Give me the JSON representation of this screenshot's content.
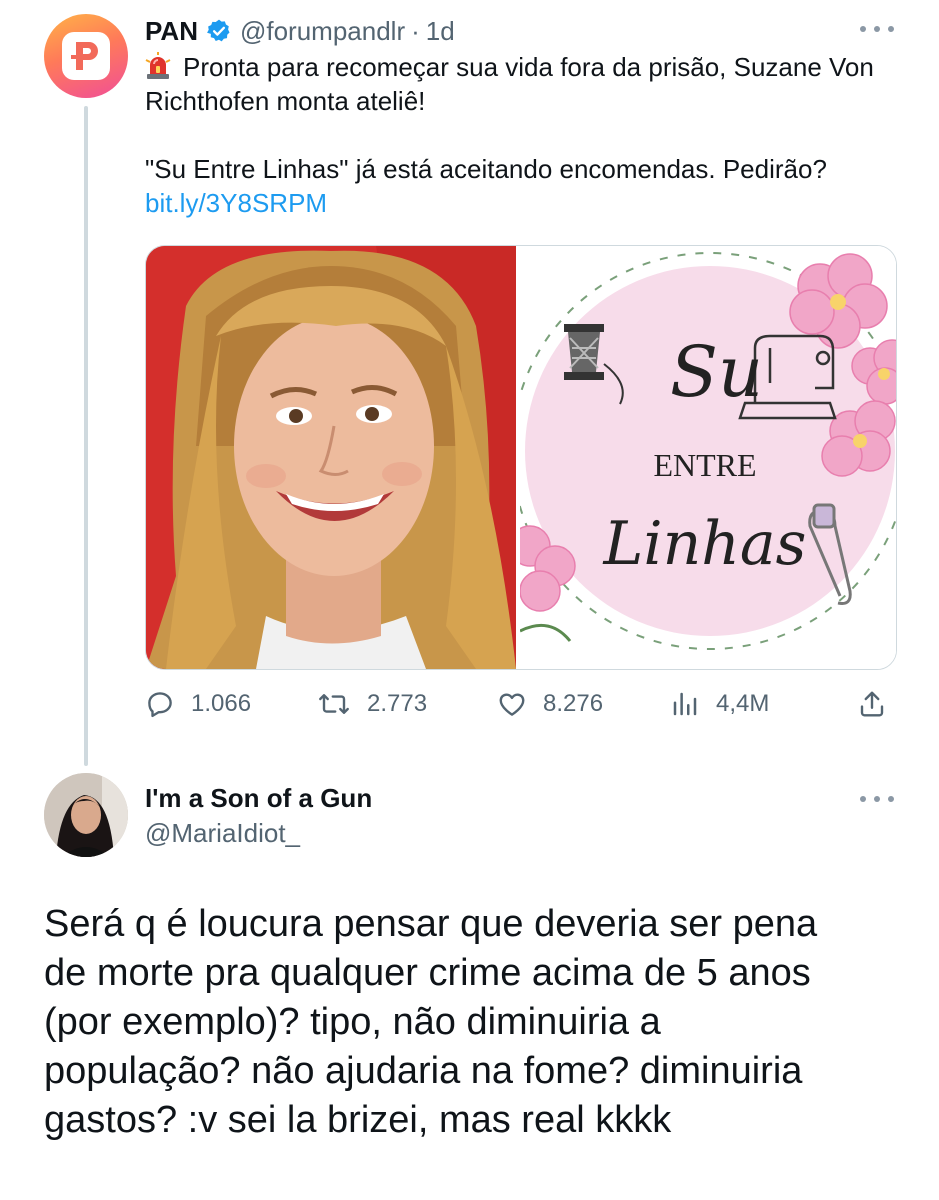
{
  "tweet": {
    "author_name": "PAN",
    "author_handle": "@forumpandlr",
    "separator": "·",
    "time": "1d",
    "text_line1": "Pronta para recomeçar sua vida fora da prisão, Suzane Von Richthofen monta ateliê!",
    "text_line2": "\"Su Entre Linhas\" já está aceitando encomendas. Pedirão?",
    "link": "bit.ly/3Y8SRPM",
    "media": {
      "logo_su": "Su",
      "logo_entre": "ENTRE",
      "logo_linhas": "Linhas"
    },
    "stats": {
      "replies": "1.066",
      "retweets": "2.773",
      "likes": "8.276",
      "views": "4,4M"
    },
    "icons": [
      "siren-icon",
      "verified-badge-icon",
      "more-icon",
      "reply-icon",
      "retweet-icon",
      "like-icon",
      "views-icon",
      "share-icon"
    ]
  },
  "reply": {
    "author_name": "I'm a Son of a Gun",
    "author_handle": "@MariaIdiot_",
    "lines": [
      "Será q é loucura pensar que deveria ser pena",
      "de morte pra qualquer crime acima de 5 anos",
      "(por exemplo)? tipo, não diminuiria a",
      "população? não ajudaria na fome? diminuiria",
      "gastos? :v sei la brizei, mas real kkkk"
    ]
  },
  "colors": {
    "text": "#0f1419",
    "muted": "#536471",
    "link": "#1d9bf0",
    "verified": "#1d9bf0",
    "thread_line": "#cfd9de",
    "photo_bg": "#d42f2c",
    "logo_circle": "#f7dcea",
    "flower": "#f1a6c8"
  }
}
